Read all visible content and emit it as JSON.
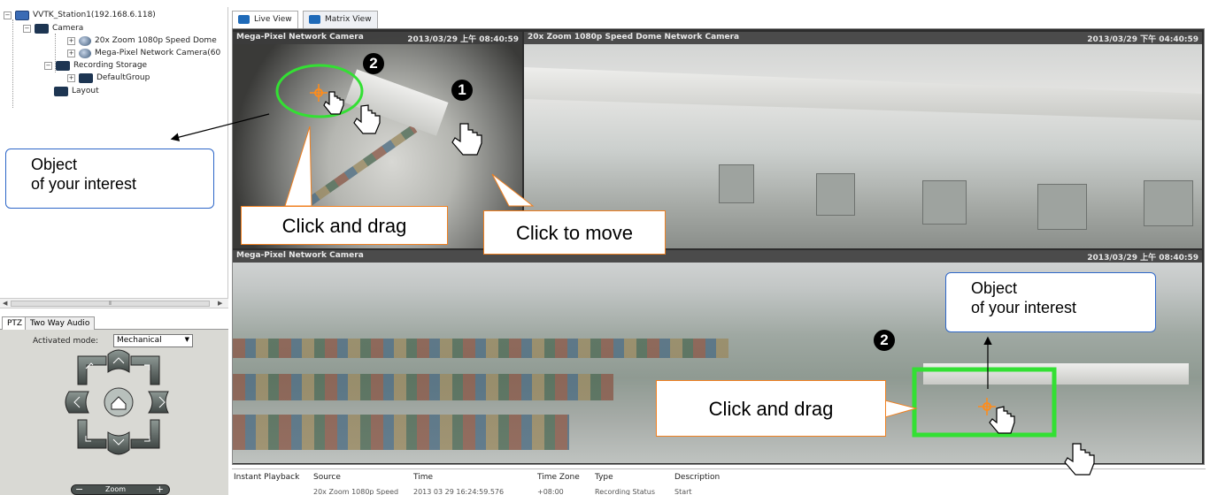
{
  "tree": {
    "station": "VVTK_Station1(192.168.6.118)",
    "camera_group": "Camera",
    "camera_1": "20x Zoom 1080p Speed Dome",
    "camera_2": "Mega-Pixel Network Camera(60",
    "recording_storage": "Recording Storage",
    "default_group": "DefaultGroup",
    "layout": "Layout"
  },
  "ptz": {
    "tab_ptz": "PTZ",
    "tab_audio": "Two Way Audio",
    "mode_label": "Activated mode:",
    "mode_value": "Mechanical",
    "zoom_label": "Zoom"
  },
  "view_tabs": {
    "live": "Live View",
    "matrix": "Matrix View"
  },
  "viewports": {
    "vp1_title": "Mega-Pixel Network Camera",
    "vp1_time": "2013/03/29 上午 08:40:59",
    "vp2_title": "20x Zoom 1080p Speed Dome Network Camera",
    "vp2_time": "2013/03/29 下午 04:40:59",
    "vp3_title": "Mega-Pixel Network Camera",
    "vp3_time": "2013/03/29 上午 08:40:59"
  },
  "events": {
    "headers": [
      "Instant Playback",
      "Source",
      "Time",
      "Time Zone",
      "Type",
      "Description"
    ],
    "row": [
      "20x Zoom 1080p Speed",
      "2013 03 29 16:24:59.576",
      "+08:00",
      "Recording Status",
      "Start"
    ]
  },
  "annotations": {
    "object_interest_left": [
      "Object",
      "of your interest"
    ],
    "object_interest_right": [
      "Object",
      "of your interest"
    ],
    "click_drag_1": "Click and drag",
    "click_move": "Click to move",
    "click_drag_2": "Click and drag",
    "badge_1": "1",
    "badge_2a": "2",
    "badge_2b": "2"
  },
  "colors": {
    "callout_border": "#f08020",
    "interest_border": "#2d66c8",
    "highlight_green": "#33e033",
    "target_orange": "#ff8c1a"
  }
}
